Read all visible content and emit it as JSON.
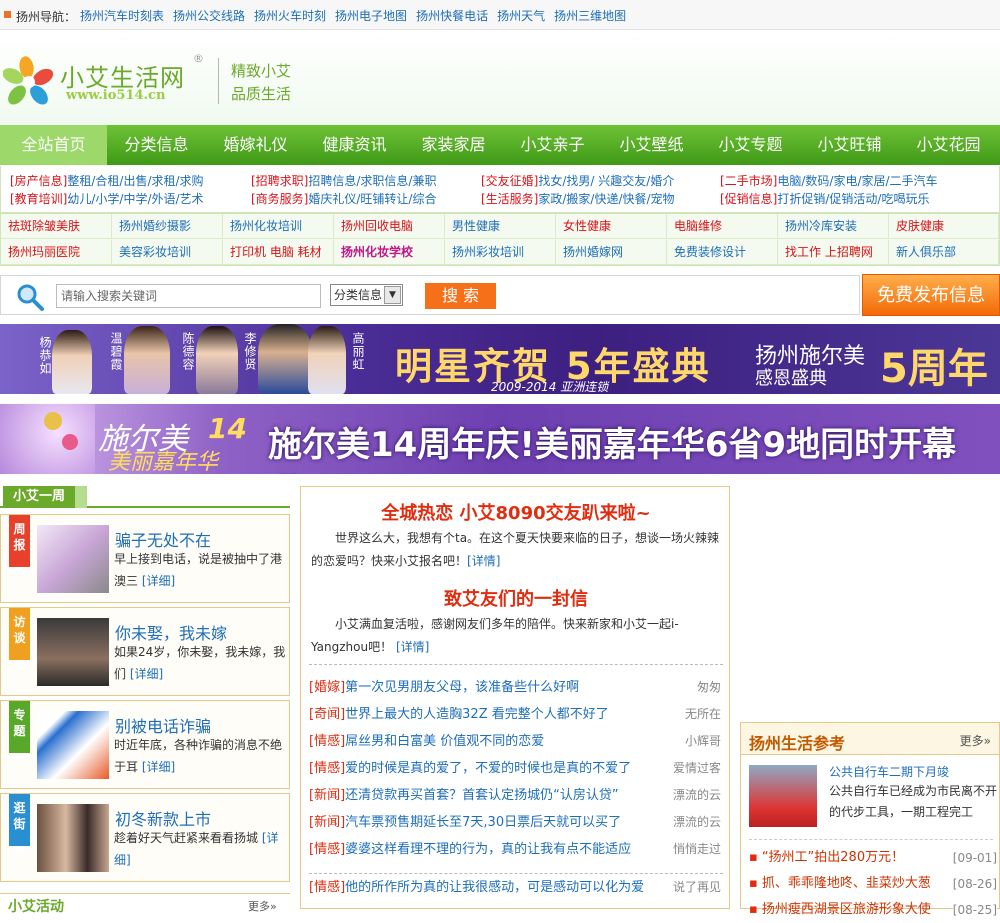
{
  "topnav": {
    "label": "扬州导航：",
    "links": [
      "扬州汽车时刻表",
      "扬州公交线路",
      "扬州火车时刻",
      "扬州电子地图",
      "扬州快餐电话",
      "扬州天气",
      "扬州三维地图"
    ]
  },
  "header": {
    "site_name": "小艾生活网",
    "reg": "®",
    "url": "www.io514.cn",
    "slogan1": "精致小艾",
    "slogan2": "品质生活"
  },
  "nav": [
    "全站首页",
    "分类信息",
    "婚嫁礼仪",
    "健康资讯",
    "家装家居",
    "小艾亲子",
    "小艾壁纸",
    "小艾专题",
    "小艾旺铺",
    "小艾花园"
  ],
  "categories": [
    {
      "head": "[房产信息]",
      "items": "整租/合租/出售/求租/求购"
    },
    {
      "head": "[招聘求职]",
      "items": "招聘信息/求职信息/兼职"
    },
    {
      "head": "[交友征婚]",
      "items": "找女/找男/ 兴趣交友/婚介"
    },
    {
      "head": "[二手市场]",
      "items": "电脑/数码/家电/家居/二手汽车"
    },
    {
      "head": "[教育培训]",
      "items": "幼儿/小学/中学/外语/艺术"
    },
    {
      "head": "[商务服务]",
      "items": "婚庆礼仪/旺铺转让/综合"
    },
    {
      "head": "[生活服务]",
      "items": "家政/搬家/快递/快餐/宠物"
    },
    {
      "head": "[促销信息]",
      "items": "打折促销/促销活动/吃喝玩乐"
    }
  ],
  "ads": [
    "祛斑除皱美肤",
    "扬州婚纱摄影",
    "扬州化妆培训",
    "扬州回收电脑",
    "男性健康",
    "女性健康",
    "电脑维修",
    "扬州冷库安装",
    "皮肤健康",
    "扬州玛丽医院",
    "美容彩妆培训",
    "打印机 电脑 耗材",
    "扬州化妆学校",
    "扬州彩妆培训",
    "扬州婚嫁网",
    "免费装修设计",
    "找工作 上招聘网",
    "新人俱乐部"
  ],
  "search": {
    "placeholder": "请输入搜索关键词",
    "select": "分类信息",
    "button": "搜 索",
    "post": "免费发布信息"
  },
  "banner1": {
    "stars": [
      "杨恭如",
      "温碧霞",
      "陈德容",
      "李修贤",
      "高丽虹"
    ],
    "headline": "明星齐贺 5年盛典",
    "years": "2009-2014 亚洲连锁",
    "right1": "扬州施尔美",
    "right2": "感恩盛典",
    "right3": "5周年"
  },
  "banner2": {
    "logo1": "施尔美",
    "logo2": "美丽嘉年华",
    "num": "14",
    "headline": "施尔美14周年庆!美丽嘉年华6省9地同时开幕啦!"
  },
  "week": {
    "title": "小艾一周",
    "cards": [
      {
        "badge": "周报",
        "color": "#e8402b",
        "title": "骗子无处不在",
        "desc": "早上接到电话，说是被抽中了港澳三",
        "more": "[详细]"
      },
      {
        "badge": "访谈",
        "color": "#f0a020",
        "title": "你未娶，我未嫁",
        "desc": "如果24岁，你未娶，我未嫁，我们",
        "more": "[详细]"
      },
      {
        "badge": "专题",
        "color": "#58a82a",
        "title": "别被电话诈骗",
        "desc": "时近年底，各种诈骗的消息不绝于耳",
        "more": "[详细]"
      },
      {
        "badge": "逛街",
        "color": "#2a8fd0",
        "title": "初冬新款上市",
        "desc": "趁着好天气赶紧来看看扬城",
        "more": "[详细]"
      }
    ]
  },
  "activity": {
    "title": "小艾活动",
    "more": "更多»"
  },
  "feature": {
    "title1": "全城热恋 小艾8090交友趴来啦~",
    "desc1": "世界这么大，我想有个ta。在这个夏天快要来临的日子，想谈一场火辣辣的恋爱吗？快来小艾报名吧！",
    "more1": "[详情]",
    "title2": "致艾友们的一封信",
    "desc2": "小艾满血复活啦，感谢网友们多年的陪伴。快来新家和小艾一起i-Yangzhou吧！",
    "more2": "[详情]"
  },
  "news": [
    {
      "cat": "[婚嫁]",
      "title": "第一次见男朋友父母，该准备些什么好啊",
      "author": "匆匆"
    },
    {
      "cat": "[奇闻]",
      "title": "世界上最大的人造胸32Z 看完整个人都不好了",
      "author": "无所在"
    },
    {
      "cat": "[情感]",
      "title": "屌丝男和白富美 价值观不同的恋爱",
      "author": "小辉哥"
    },
    {
      "cat": "[情感]",
      "title": "爱的时候是真的爱了，不爱的时候也是真的不爱了",
      "author": "爱情过客"
    },
    {
      "cat": "[新闻]",
      "title": "还清贷款再买首套？首套认定扬城仍“认房认贷”",
      "author": "漂流的云"
    },
    {
      "cat": "[新闻]",
      "title": "汽车票预售期延长至7天,30日票后天就可以买了",
      "author": "漂流的云"
    },
    {
      "cat": "[情感]",
      "title": "婆婆这样看理不理的行为，真的让我有点不能适应",
      "author": "悄悄走过"
    },
    {
      "cat": "[情感]",
      "title": "他的所作所为真的让我很感动，可是感动可以化为爱",
      "author": "说了再见"
    }
  ],
  "ref": {
    "title": "扬州生活参考",
    "more": "更多»",
    "feat_title": "公共自行车二期下月竣",
    "feat_desc": "公共自行车已经成为市民离不开的代步工具，一期工程完工",
    "items": [
      {
        "bullet": "▪",
        "title": "“扬州工”拍出280万元！",
        "date": "[09-01]"
      },
      {
        "bullet": "▪",
        "title": "抓、乖乖隆地咚、韭菜炒大葱",
        "date": "[08-26]"
      },
      {
        "bullet": "▪",
        "title": "扬州瘦西湖景区旅游形象大使",
        "date": "[08-25]"
      }
    ]
  }
}
